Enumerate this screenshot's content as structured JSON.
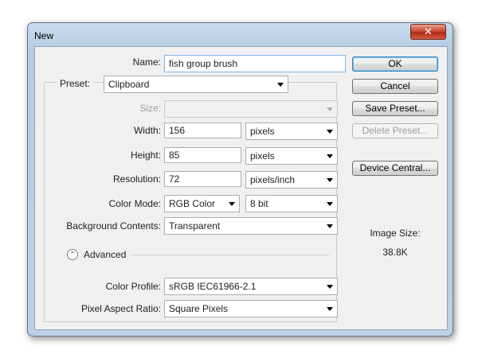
{
  "window": {
    "title": "New",
    "close_glyph": "✕"
  },
  "name": {
    "label": "Name:",
    "value": "fish group brush"
  },
  "preset": {
    "label": "Preset:",
    "value": "Clipboard"
  },
  "size": {
    "label": "Size:",
    "value": ""
  },
  "width": {
    "label": "Width:",
    "value": "156",
    "unit": "pixels"
  },
  "height": {
    "label": "Height:",
    "value": "85",
    "unit": "pixels"
  },
  "resolution": {
    "label": "Resolution:",
    "value": "72",
    "unit": "pixels/inch"
  },
  "color_mode": {
    "label": "Color Mode:",
    "value": "RGB Color",
    "depth": "8 bit"
  },
  "background": {
    "label": "Background Contents:",
    "value": "Transparent"
  },
  "advanced": {
    "label": "Advanced",
    "toggle_glyph": "⌃"
  },
  "color_profile": {
    "label": "Color Profile:",
    "value": "sRGB IEC61966-2.1"
  },
  "pixel_aspect": {
    "label": "Pixel Aspect Ratio:",
    "value": "Square Pixels"
  },
  "buttons": {
    "ok": "OK",
    "cancel": "Cancel",
    "save_preset": "Save Preset...",
    "delete_preset": "Delete Preset...",
    "device_central": "Device Central..."
  },
  "image_size": {
    "label": "Image Size:",
    "value": "38.8K"
  },
  "colors": {
    "frame": "#bcd1e8",
    "close": "#c9452f",
    "client": "#f0f0f0",
    "default_button": "#3c7fb1"
  }
}
